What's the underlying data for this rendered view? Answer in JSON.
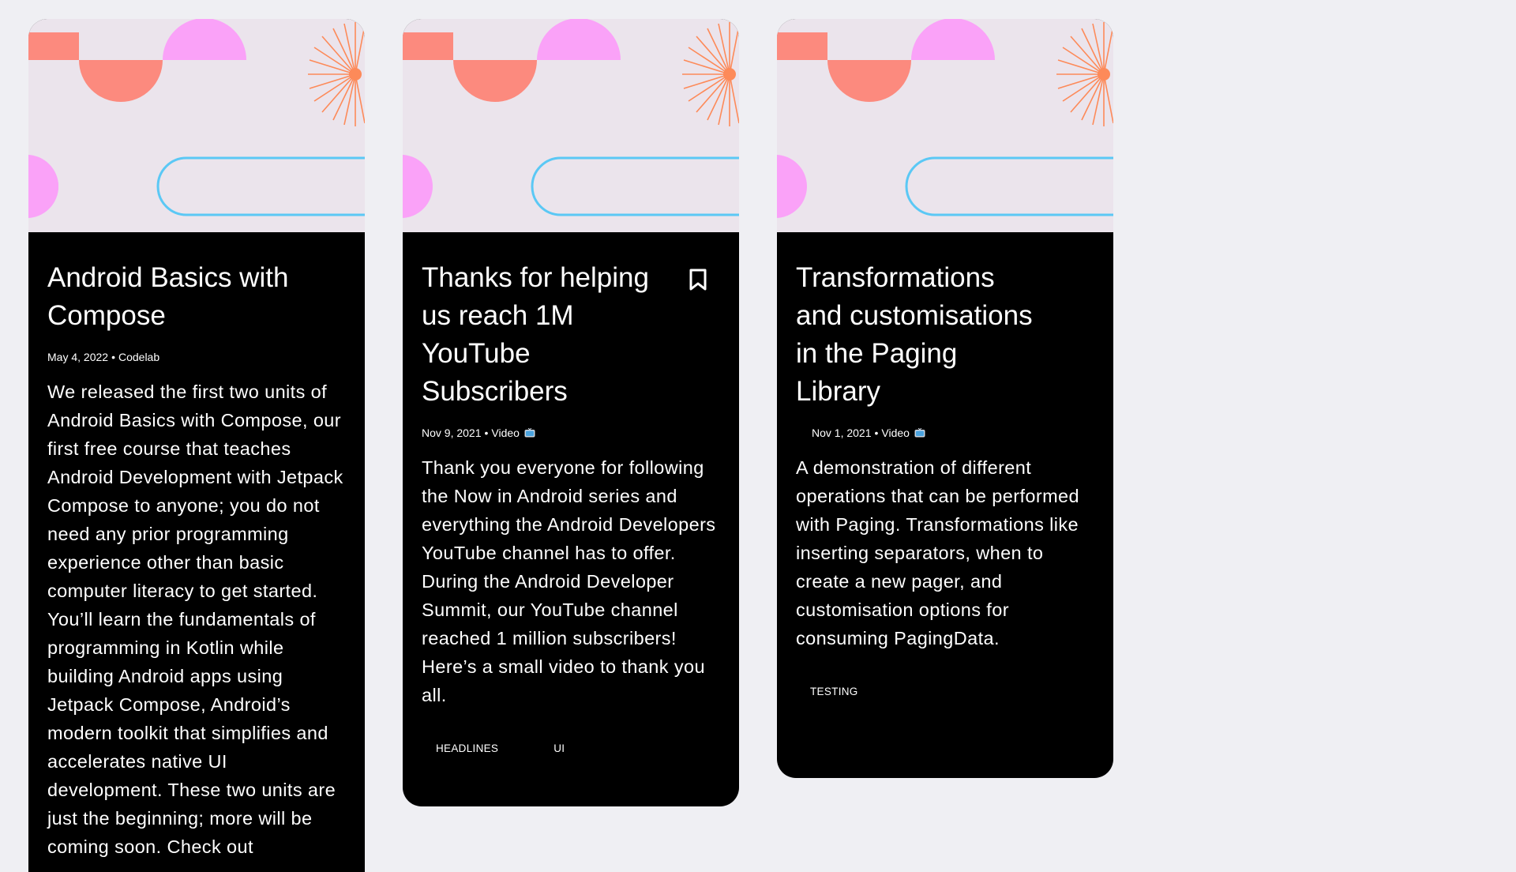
{
  "colors": {
    "page_bg": "#efeff3",
    "card_bg": "#000000",
    "header_bg": "#ebe4ec",
    "coral": "#fc8a7e",
    "pink": "#faa2f8",
    "orange": "#fd8a59",
    "blue": "#5bc8f5"
  },
  "cards": [
    {
      "title": "Android Basics with Compose",
      "date": "May 4, 2022",
      "separator": "•",
      "type": "Codelab",
      "bookmarked": false,
      "description": "We released the first two units of Android Basics with Compose, our first free course that teaches Android Development with Jetpack Compose to anyone; you do not need any prior programming experience other than basic computer literacy to get started. You’ll learn the fundamentals of programming in Kotlin while building Android apps using Jetpack Compose, Android’s modern toolkit that simplifies and accelerates native UI development. These two units are just the beginning; more will be coming soon. Check out",
      "tags": []
    },
    {
      "title": "Thanks for helping us reach 1M YouTube Subscribers",
      "date": "Nov 9, 2021",
      "separator": "•",
      "type": "Video",
      "type_icon": "tv-icon",
      "bookmarked": false,
      "description": "Thank you everyone for following the Now in Android series and everything the Android Developers YouTube channel has to offer. During the Android Developer Summit, our YouTube channel reached 1 million subscribers! Here’s a small video to thank you all.",
      "tags": [
        "HEADLINES",
        "UI"
      ]
    },
    {
      "title": "Transformations and customisations in the Paging Library",
      "date": "Nov 1, 2021",
      "separator": "•",
      "type": "Video",
      "type_icon": "tv-icon",
      "bookmarked": false,
      "description": "A demonstration of different operations that can be performed with Paging. Transformations like inserting separators, when to create a new pager, and customisation options for consuming PagingData.",
      "tags": [
        "TESTING"
      ]
    }
  ]
}
